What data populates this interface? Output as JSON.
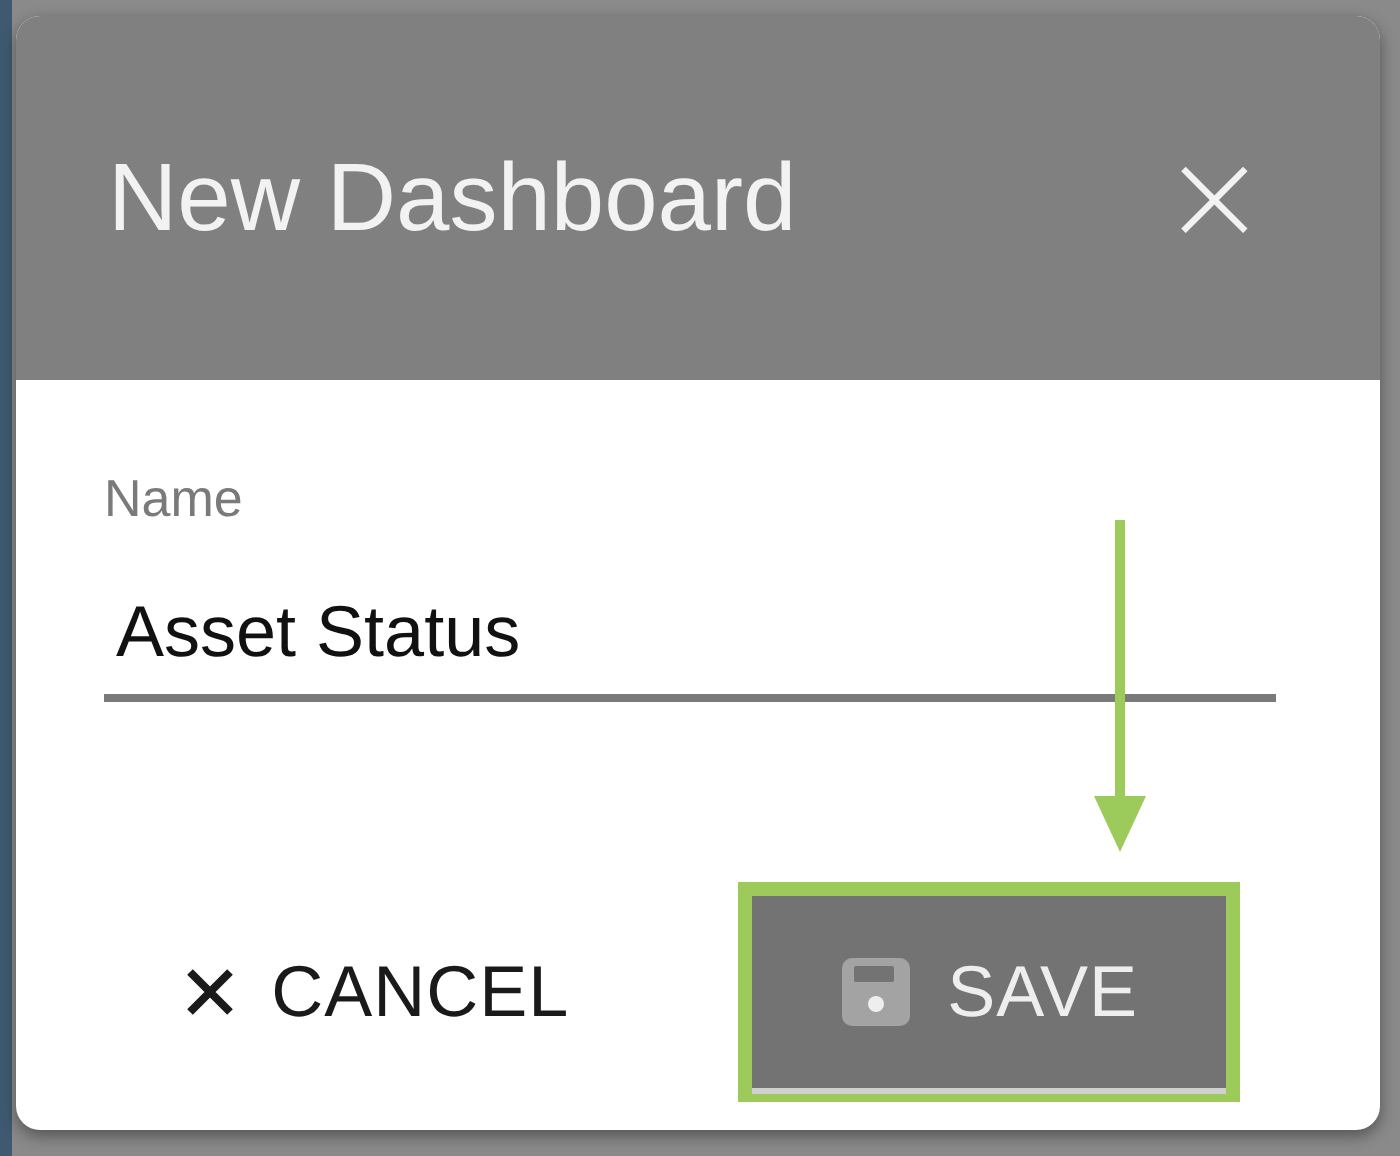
{
  "dialog": {
    "title": "New Dashboard",
    "close_icon": "×"
  },
  "field": {
    "label": "Name",
    "value": "Asset Status"
  },
  "buttons": [
    {
      "kind": "text",
      "label": "CANCEL",
      "highlighted": false
    },
    {
      "kind": "contained",
      "label": "SAVE",
      "highlighted": true
    }
  ]
}
